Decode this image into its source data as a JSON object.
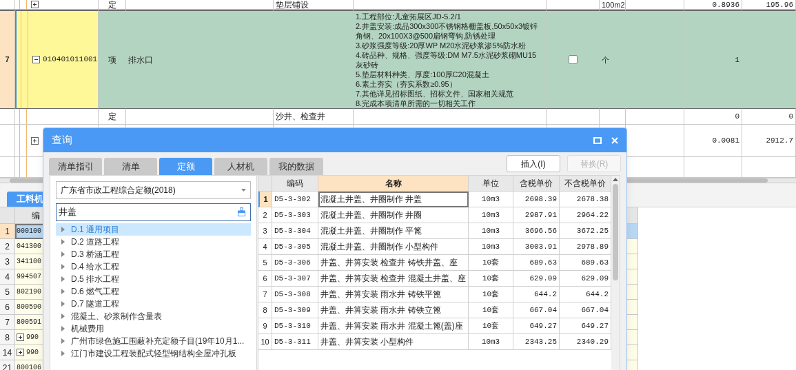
{
  "main_grid": {
    "rows": [
      {
        "expanded": false,
        "type": "定",
        "column_5": "垫层铺设",
        "unit": "100m2",
        "column_10": "0.8936",
        "column_11": "195.96",
        "selected": false
      },
      {
        "number": "7",
        "expanded": true,
        "code": "010401011001",
        "type": "项",
        "name": "排水口",
        "features": "1.工程部位:儿童拓展区JD-5.2/1\n2.井盖安装:成品300x300不锈钢格栅盖板,50x50x3镀锌角钢、20x100X3@500扁钢弯钩,防锈处理\n3.砂浆强度等级:20厚WP M20水泥砂浆渗5%防水粉\n4.砖品种、规格、强度等级:DM M7.5水泥砂浆砌MU15灰砂砖\n5.垫层材料种类、厚度:100厚C20混凝土\n6.素土夯实（夯实系数≥0.95）\n7.其他详见招标图纸、招标文件、国家相关规范\n8.完成本项清单所需的一切相关工作",
        "checked": false,
        "unit": "个",
        "column_10": "1",
        "selected": true
      },
      {
        "type": "定",
        "column_5": "沙井、检查井",
        "column_10": "0",
        "column_11": "0",
        "selected": false
      },
      {
        "expanded": false,
        "column_10": "0.0081",
        "column_11": "2912.7",
        "selected": false
      }
    ]
  },
  "lower_panel": {
    "tab": "工料机",
    "header": "编",
    "rows": [
      {
        "number": "1",
        "code": "000100",
        "selected": true
      },
      {
        "number": "2",
        "code": "041300",
        "selected": false
      },
      {
        "number": "3",
        "code": "341100",
        "selected": false
      },
      {
        "number": "4",
        "code": "994507",
        "selected": false
      },
      {
        "number": "5",
        "code": "802190",
        "selected": false
      },
      {
        "number": "6",
        "code": "800590",
        "selected": false
      },
      {
        "number": "7",
        "code": "800591",
        "selected": false
      },
      {
        "number": "8",
        "expanded": false,
        "code": "990",
        "selected": false
      },
      {
        "number": "14",
        "expanded": false,
        "code": "990",
        "selected": false
      },
      {
        "number": "21",
        "code": "800106",
        "selected": false
      }
    ]
  },
  "dialog": {
    "title": "查询",
    "tabs": [
      {
        "label": "清单指引",
        "selected": false
      },
      {
        "label": "清单",
        "selected": false
      },
      {
        "label": "定额",
        "selected": true
      },
      {
        "label": "人材机",
        "selected": false
      },
      {
        "label": "我的数据",
        "selected": false
      }
    ],
    "buttons": [
      {
        "label": "插入(I)",
        "disabled": false
      },
      {
        "label": "替换(R)",
        "disabled": true
      }
    ],
    "library": "广东省市政工程综合定额(2018)",
    "search": {
      "value": "井盖"
    },
    "tree": [
      {
        "label": "D.1 通用项目",
        "selected": true,
        "expanded": false
      },
      {
        "label": "D.2 道路工程",
        "selected": false,
        "expanded": false
      },
      {
        "label": "D.3 桥涵工程",
        "selected": false,
        "expanded": false
      },
      {
        "label": "D.4 给水工程",
        "selected": false,
        "expanded": false
      },
      {
        "label": "D.5 排水工程",
        "selected": false,
        "expanded": false
      },
      {
        "label": "D.6 燃气工程",
        "selected": false,
        "expanded": false
      },
      {
        "label": "D.7 隧道工程",
        "selected": false,
        "expanded": false
      },
      {
        "label": "混凝土、砂浆制作含量表",
        "selected": false,
        "expanded": false
      },
      {
        "label": "机械费用",
        "selected": false,
        "expanded": false
      },
      {
        "label": "广州市绿色施工围蔽补充定额子目(19年10月1...",
        "selected": false,
        "expanded": false
      },
      {
        "label": "江门市建设工程装配式轻型钢结构全屋冲孔板",
        "selected": false,
        "expanded": false
      }
    ],
    "table": {
      "columns": [
        "编码",
        "名称",
        "单位",
        "含税单价",
        "不含税单价"
      ],
      "rows": [
        {
          "number": "1",
          "code": "D5-3-302",
          "name": "混凝土井盖、井圈制作 井盖",
          "unit": "10m3",
          "tax_price": "2698.39",
          "price": "2678.38",
          "selected": true
        },
        {
          "number": "2",
          "code": "D5-3-303",
          "name": "混凝土井盖、井圈制作 井圈",
          "unit": "10m3",
          "tax_price": "2987.91",
          "price": "2964.22",
          "selected": false
        },
        {
          "number": "3",
          "code": "D5-3-304",
          "name": "混凝土井盖、井圈制作 平篦",
          "unit": "10m3",
          "tax_price": "3696.56",
          "price": "3672.25",
          "selected": false
        },
        {
          "number": "4",
          "code": "D5-3-305",
          "name": "混凝土井盖、井圈制作 小型构件",
          "unit": "10m3",
          "tax_price": "3003.91",
          "price": "2978.89",
          "selected": false
        },
        {
          "number": "5",
          "code": "D5-3-306",
          "name": "井盖、井箅安装 检查井 铸铁井盖、座",
          "unit": "10套",
          "tax_price": "689.63",
          "price": "689.63",
          "selected": false
        },
        {
          "number": "6",
          "code": "D5-3-307",
          "name": "井盖、井箅安装 检查井 混凝土井盖、座",
          "unit": "10套",
          "tax_price": "629.09",
          "price": "629.09",
          "selected": false
        },
        {
          "number": "7",
          "code": "D5-3-308",
          "name": "井盖、井箅安装 雨水井 铸铁平篦",
          "unit": "10套",
          "tax_price": "644.2",
          "price": "644.2",
          "selected": false
        },
        {
          "number": "8",
          "code": "D5-3-309",
          "name": "井盖、井箅安装 雨水井 铸铁立篦",
          "unit": "10套",
          "tax_price": "667.04",
          "price": "667.04",
          "selected": false
        },
        {
          "number": "9",
          "code": "D5-3-310",
          "name": "井盖、井箅安装 雨水井 混凝土篦(盖)座",
          "unit": "10套",
          "tax_price": "649.27",
          "price": "649.27",
          "selected": false
        },
        {
          "number": "10",
          "code": "D5-3-311",
          "name": "井盖、井箅安装 小型构件",
          "unit": "10m3",
          "tax_price": "2343.25",
          "price": "2340.29",
          "selected": false
        }
      ]
    }
  }
}
